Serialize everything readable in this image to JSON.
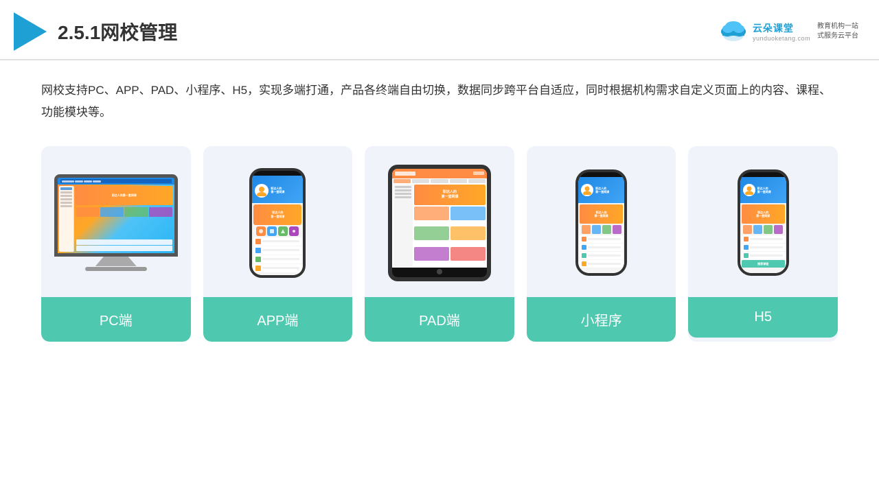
{
  "header": {
    "title": "2.5.1网校管理",
    "brand": {
      "name": "云朵课堂",
      "url": "yunduoketang.com",
      "slogan": "教育机构一站\n式服务云平台"
    }
  },
  "description": "网校支持PC、APP、PAD、小程序、H5，实现多端打通，产品各终端自由切换，数据同步跨平台自适应，同时根据机构需求自定义页面上的内容、课程、功能模块等。",
  "cards": [
    {
      "id": "pc",
      "label": "PC端"
    },
    {
      "id": "app",
      "label": "APP端"
    },
    {
      "id": "pad",
      "label": "PAD端"
    },
    {
      "id": "miniprogram",
      "label": "小程序"
    },
    {
      "id": "h5",
      "label": "H5"
    }
  ]
}
